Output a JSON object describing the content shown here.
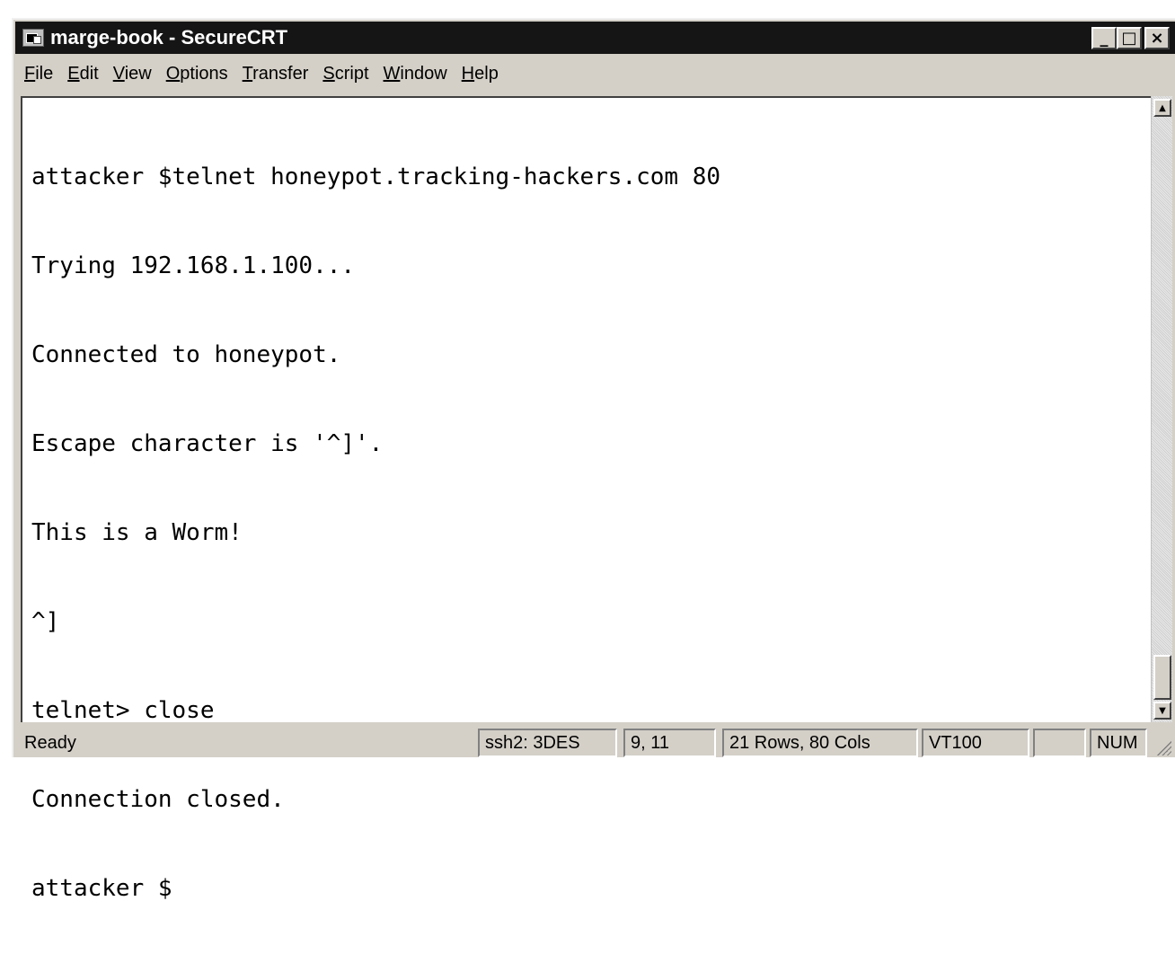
{
  "window": {
    "title": "marge-book - SecureCRT",
    "buttons": {
      "minimize": "_",
      "maximize": "□",
      "close": "×"
    }
  },
  "menu": [
    {
      "label": "File",
      "accel": "F",
      "rest": "ile"
    },
    {
      "label": "Edit",
      "accel": "E",
      "rest": "dit"
    },
    {
      "label": "View",
      "accel": "V",
      "rest": "iew"
    },
    {
      "label": "Options",
      "accel": "O",
      "rest": "ptions"
    },
    {
      "label": "Transfer",
      "accel": "T",
      "rest": "ransfer"
    },
    {
      "label": "Script",
      "accel": "S",
      "rest": "cript"
    },
    {
      "label": "Window",
      "accel": "W",
      "rest": "indow"
    },
    {
      "label": "Help",
      "accel": "H",
      "rest": "elp"
    }
  ],
  "terminal": {
    "lines": [
      "attacker $telnet honeypot.tracking-hackers.com 80",
      "Trying 192.168.1.100...",
      "Connected to honeypot.",
      "Escape character is '^]'.",
      "This is a Worm!",
      "^]",
      "telnet> close",
      "Connection closed.",
      "attacker $"
    ]
  },
  "scrollbar": {
    "up_arrow": "▲",
    "down_arrow": "▼"
  },
  "status": {
    "ready": "Ready",
    "cipher": "ssh2: 3DES",
    "cursor": "9,  11",
    "size": "21 Rows,  80 Cols",
    "emulation": "VT100",
    "blank": "",
    "num": "NUM"
  }
}
